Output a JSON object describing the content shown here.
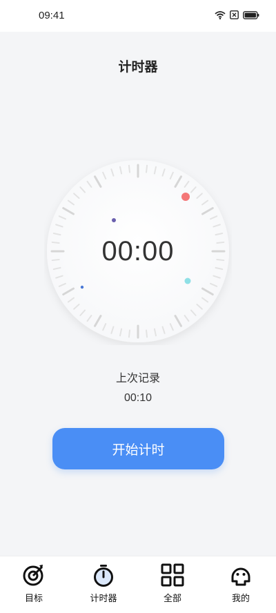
{
  "status_bar": {
    "time": "09:41"
  },
  "header": {
    "title": "计时器"
  },
  "timer": {
    "display": "00:00"
  },
  "last_record": {
    "label": "上次记录",
    "value": "00:10"
  },
  "start_button": {
    "label": "开始计时"
  },
  "tabs": [
    {
      "label": "目标",
      "icon": "target-icon"
    },
    {
      "label": "计时器",
      "icon": "stopwatch-icon"
    },
    {
      "label": "全部",
      "icon": "grid-icon"
    },
    {
      "label": "我的",
      "icon": "face-icon"
    }
  ],
  "colors": {
    "accent": "#4a8ef5",
    "dot_red": "#f47777",
    "dot_purple": "#6a5fae",
    "dot_cyan": "#8fe0e6",
    "dot_blue": "#4a78d6"
  }
}
